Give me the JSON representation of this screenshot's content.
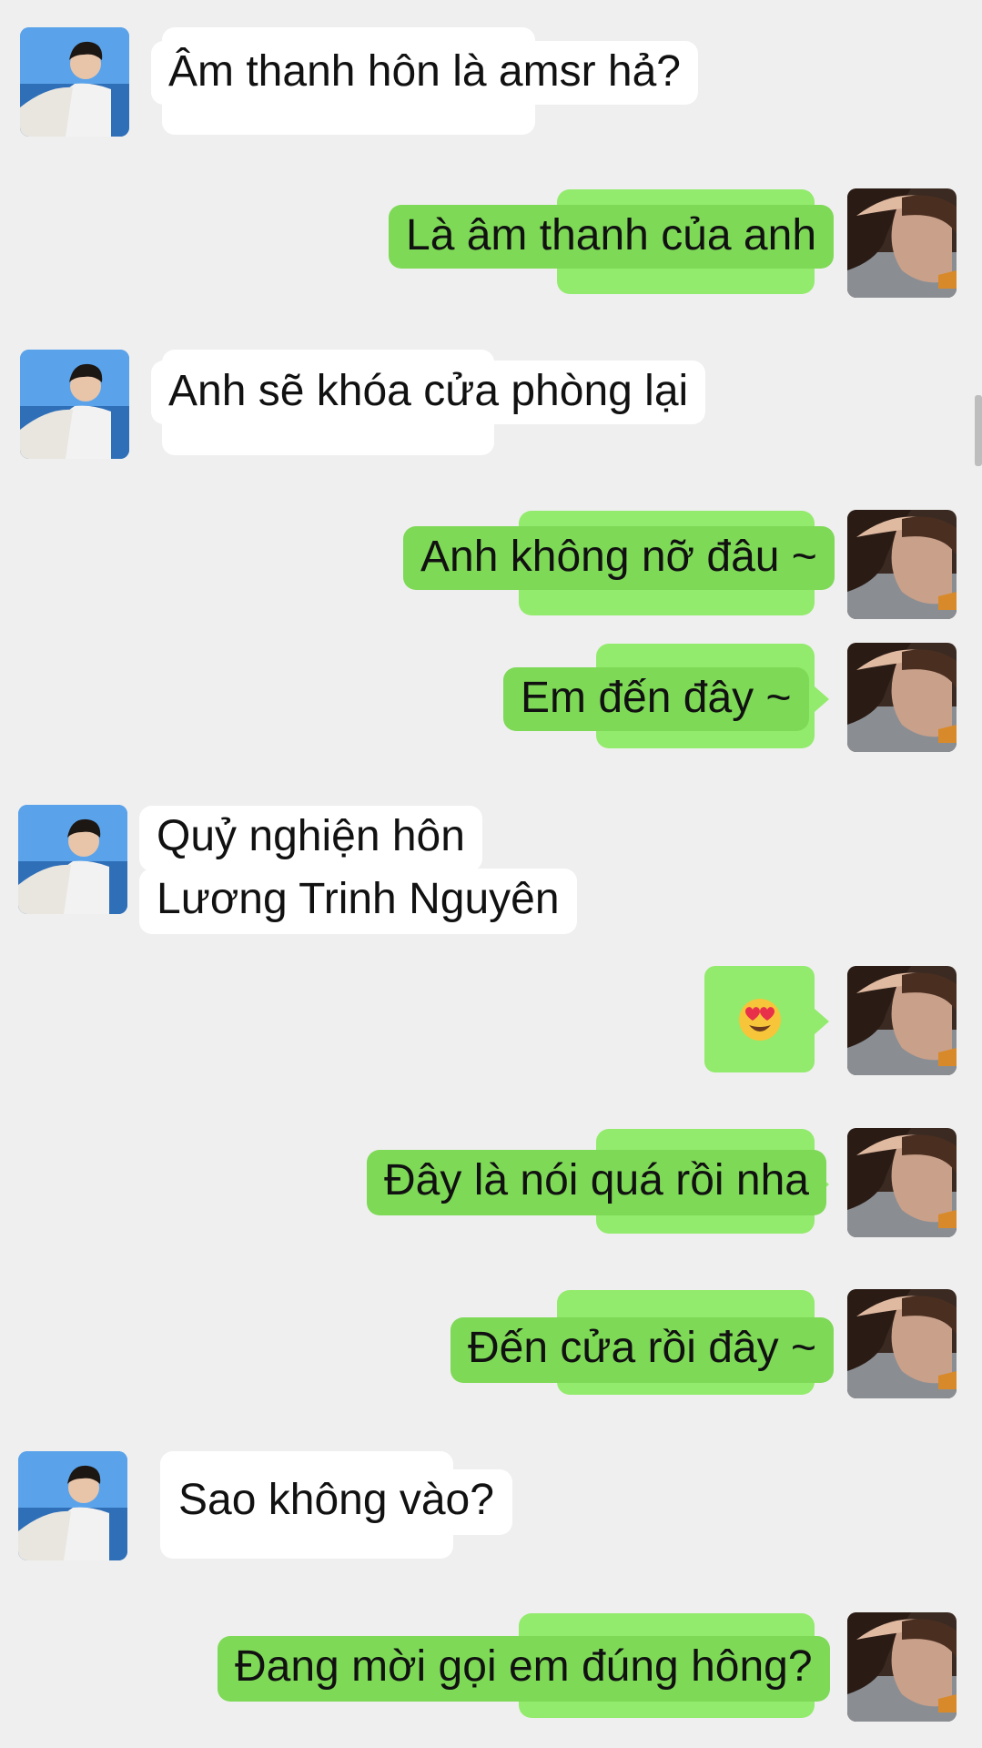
{
  "conversation": {
    "messages": [
      {
        "sender": "other",
        "text": "Âm thanh hôn là amsr hả?"
      },
      {
        "sender": "me",
        "text": "Là âm thanh của anh"
      },
      {
        "sender": "other",
        "text": "Anh sẽ khóa cửa phòng lại"
      },
      {
        "sender": "me",
        "text": "Anh không nỡ đâu ~"
      },
      {
        "sender": "me",
        "text": "Em đến đây ~"
      },
      {
        "sender": "other",
        "line1": "Quỷ nghiện hôn",
        "line2": "Lương Trinh Nguyên"
      },
      {
        "sender": "me",
        "emoji": "heart-eyes-emoji"
      },
      {
        "sender": "me",
        "text": "Đây là nói quá rồi nha"
      },
      {
        "sender": "me",
        "text": "Đến cửa rồi đây ~"
      },
      {
        "sender": "other",
        "text": "Sao không vào?"
      },
      {
        "sender": "me",
        "text": "Đang mời gọi em đúng hông?"
      }
    ]
  },
  "colors": {
    "background": "#efefef",
    "incoming_bubble": "#ffffff",
    "outgoing_bubble": "#7ed957",
    "outgoing_bubble_shadow": "#92eb6c",
    "text": "#111111"
  }
}
